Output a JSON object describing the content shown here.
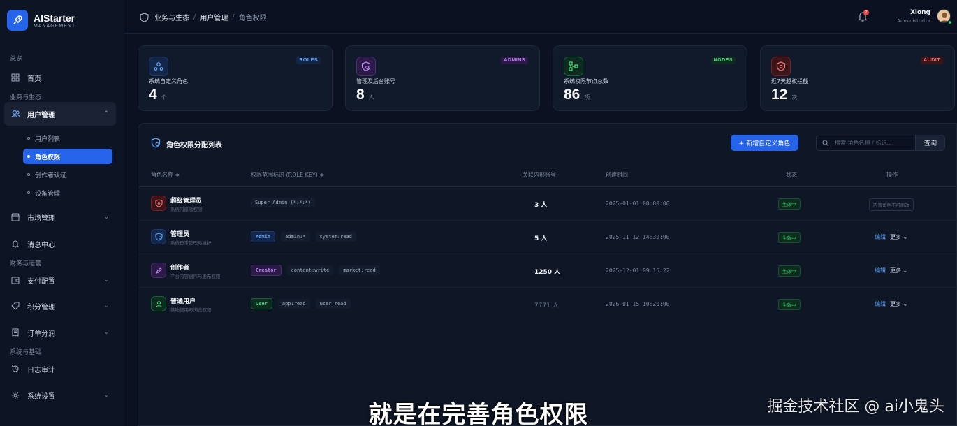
{
  "brand": {
    "name": "AIStarter",
    "sub": "MANAGEMENT"
  },
  "sidebar": {
    "groups": [
      "总览",
      "业务与生态",
      "财务与运营",
      "系统与基础"
    ],
    "home": "首页",
    "user_mgmt": "用户管理",
    "subitems": [
      "用户列表",
      "角色权限",
      "创作者认证",
      "设备管理"
    ],
    "market": "市场管理",
    "messages": "消息中心",
    "payment": "支付配置",
    "points": "积分管理",
    "orders": "订单分润",
    "logs": "日志审计",
    "settings": "系统设置"
  },
  "breadcrumb": {
    "a": "业务与生态",
    "b": "用户管理",
    "c": "角色权限",
    "sep": "/"
  },
  "notifications": {
    "count": "2"
  },
  "user": {
    "name": "Xiong",
    "role": "Administrator"
  },
  "stats": [
    {
      "tag": "ROLES",
      "label": "系统自定义角色",
      "value": "4",
      "unit": "个",
      "color": "#60a5fa"
    },
    {
      "tag": "ADMINS",
      "label": "管理及后台账号",
      "value": "8",
      "unit": "人",
      "color": "#c084fc"
    },
    {
      "tag": "NODES",
      "label": "系统权限节点总数",
      "value": "86",
      "unit": "项",
      "color": "#4ade80"
    },
    {
      "tag": "AUDIT",
      "label": "近7天越权拦截",
      "value": "12",
      "unit": "次",
      "color": "#f87171"
    }
  ],
  "panel": {
    "title": "角色权限分配列表",
    "add_button": "+ 新增自定义角色",
    "search_placeholder": "搜索 角色名称 / 标识...",
    "query_button": "查询"
  },
  "table": {
    "headers": [
      "角色名称 ≑",
      "权限范围标识 (ROLE KEY) ≑",
      "关联内部账号",
      "创建时间",
      "状态",
      "操作"
    ],
    "rows": [
      {
        "name": "超级管理员",
        "desc": "系统内最高权限",
        "keys": [
          "Super_Admin (*:*:*)"
        ],
        "count": "3 人",
        "date": "2025-01-01 00:00:00",
        "status": "生效中",
        "locked": "内置角色不可删改"
      },
      {
        "name": "管理员",
        "desc": "系统日常管理与维护",
        "keys": [
          "Admin",
          "admin:*",
          "system:read"
        ],
        "count": "5 人",
        "date": "2025-11-12 14:30:00",
        "status": "生效中",
        "edit": "编辑",
        "more": "更多 ⌄"
      },
      {
        "name": "创作者",
        "desc": "平台内容创作与发布权限",
        "keys": [
          "Creator",
          "content:write",
          "market:read"
        ],
        "count": "1250 人",
        "date": "2025-12-01 09:15:22",
        "status": "生效中",
        "edit": "编辑",
        "more": "更多 ⌄"
      },
      {
        "name": "普通用户",
        "desc": "基础使用与浏览权限",
        "keys": [
          "User",
          "app:read",
          "user:read"
        ],
        "count": "7771 人",
        "date": "2026-01-15 10:20:00",
        "status": "生效中",
        "edit": "编辑",
        "more": "更多 ⌄"
      }
    ]
  },
  "overlay": {
    "subtitle": "就是在完善角色权限",
    "watermark": "掘金技术社区 @ ai小鬼头"
  }
}
